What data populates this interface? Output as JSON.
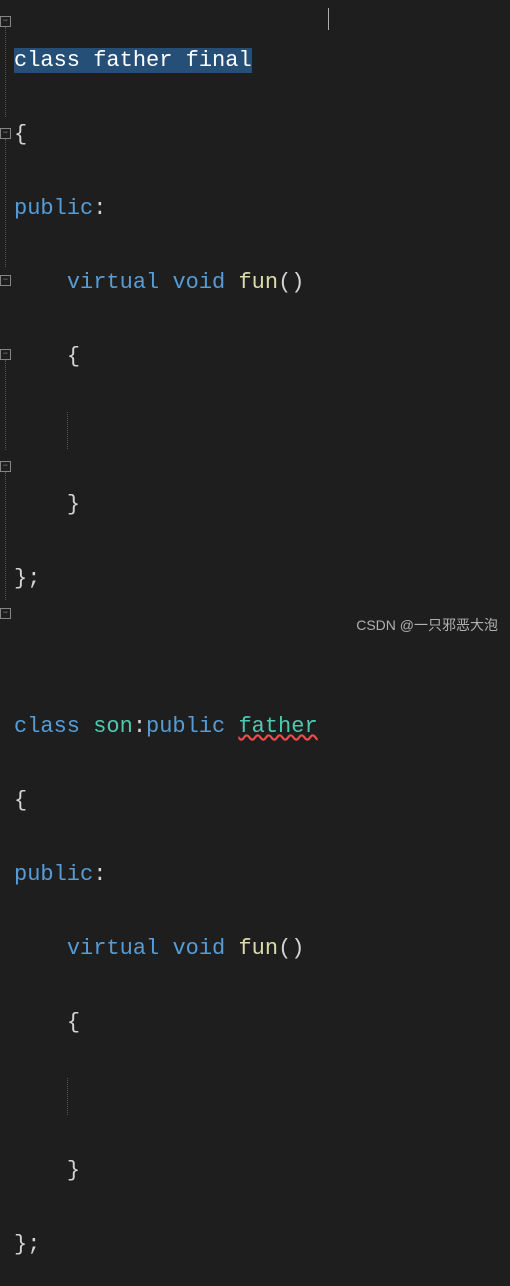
{
  "code": {
    "line1_selected": {
      "class_kw": "class",
      "name": "father",
      "final_kw": "final"
    },
    "line2_brace_open": "{",
    "line3_public": "public",
    "line4": {
      "virtual_kw": "virtual",
      "void_kw": "void",
      "func_name": "fun",
      "parens": "()"
    },
    "line5_brace_open": "{",
    "line6_brace_close": "}",
    "line7_close": "};",
    "blank": "",
    "line9": {
      "class_kw": "class",
      "child_name": "son",
      "colon": ":",
      "public_kw": "public",
      "base_name": "father"
    },
    "line10_brace_open": "{",
    "line11_public": "public",
    "line12": {
      "virtual_kw": "virtual",
      "void_kw": "void",
      "func_name": "fun",
      "parens": "()"
    },
    "line13_brace_open": "{",
    "line14_brace_close": "}",
    "line15_close": "};"
  },
  "watermark": "CSDN @一只邪恶大泡"
}
